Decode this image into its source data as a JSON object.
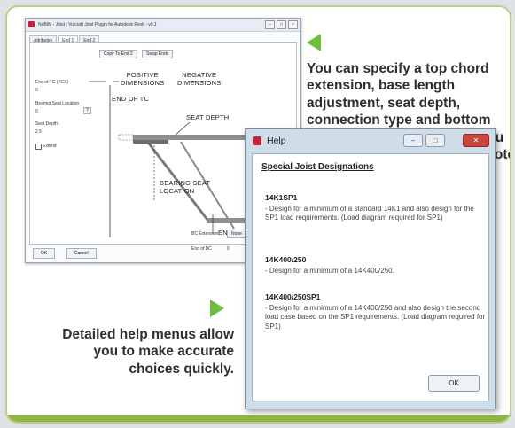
{
  "main_window": {
    "title": "NuBIM - Joist | Vulcraft Joist Plugin for Autodesk Revit - v0.1",
    "tabs": [
      "Attributes",
      "End 1",
      "End 2"
    ],
    "copy_button": "Copy To End 2",
    "swap_button": "Swap Ends",
    "fields": {
      "end_of_tc_label": "End of TC (TCX)",
      "end_of_tc_value": "0",
      "bearing_seat_label": "Bearing Seat Location",
      "bearing_seat_value": "0",
      "seat_depth_label": "Seat Depth",
      "seat_depth_value": "2.5",
      "extend_label": "Extend",
      "bc_extension_label": "BC Extension",
      "bc_extension_value": "None",
      "end_of_bc_label": "End of BC",
      "end_of_bc_value": "0"
    },
    "diagram": {
      "positive": "POSITIVE",
      "negative": "NEGATIVE",
      "dimensions": "DIMENSIONS",
      "end_of_tc": "END OF TC",
      "seat_depth": "SEAT DEPTH",
      "bearing_seat": "BEARING SEAT",
      "location": "LOCATION",
      "end_of_bc": "END OF BC"
    },
    "ok_button": "OK",
    "cancel_button": "Cancel"
  },
  "captions": {
    "top": "You can specify a top chord extension, base length adjustment, seat depth, connection type and bottom chord extension, allowing you to formulate a more exact quote.",
    "bottom": "Detailed help menus allow you to make accurate choices quickly."
  },
  "help_dialog": {
    "title": "Help",
    "heading": "Special Joist Designations",
    "sections": [
      {
        "title": "14K1SP1",
        "text": "- Design for a minimum of a standard 14K1 and also design for the SP1 load requirements. (Load diagram required for SP1)"
      },
      {
        "title": "14K400/250",
        "text": "- Design for a minimum of a 14K400/250."
      },
      {
        "title": "14K400/250SP1",
        "text": "- Design for a minimum of a 14K400/250 and also design the second load case based on the SP1 requirements. (Load diagram required for SP1)"
      }
    ],
    "ok_button": "OK"
  },
  "colors": {
    "accent_green": "#6bbf3a",
    "border_green": "#b9d08a",
    "strip_green": "#8fb54a"
  }
}
